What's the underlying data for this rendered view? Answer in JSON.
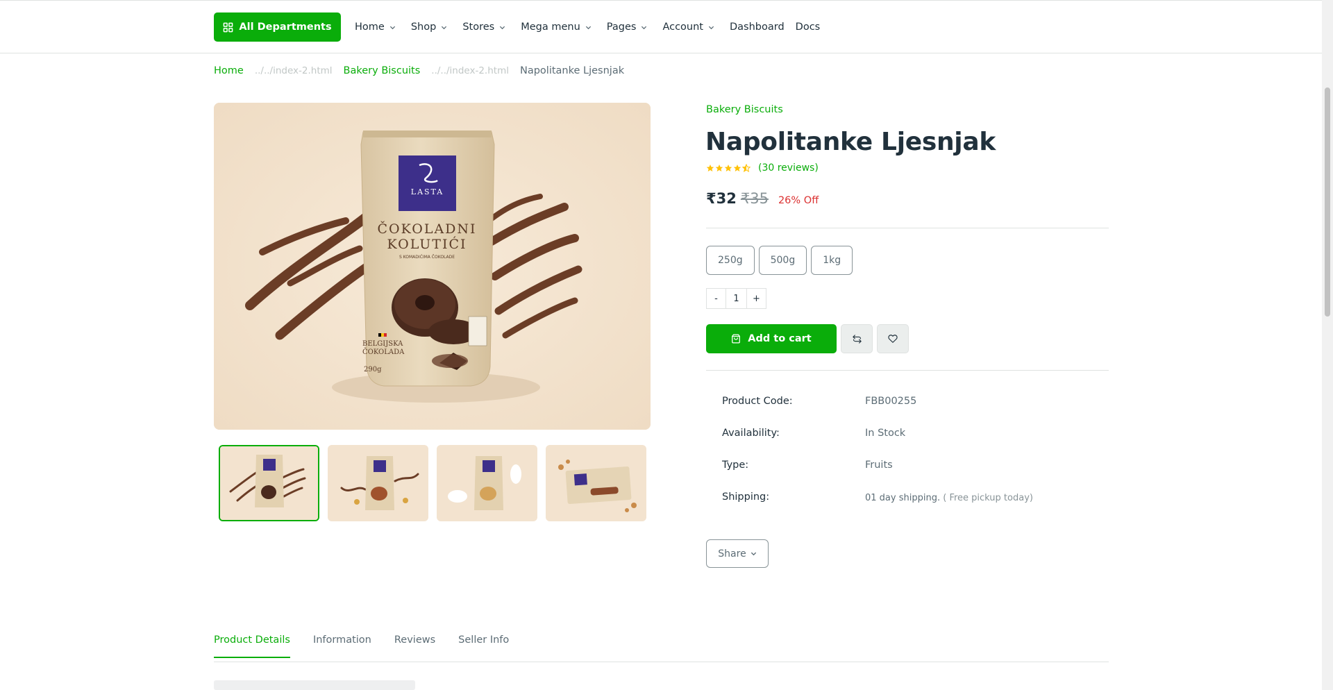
{
  "header": {
    "departments_label": "All Departments",
    "nav": [
      {
        "label": "Home",
        "dropdown": true
      },
      {
        "label": "Shop",
        "dropdown": true
      },
      {
        "label": "Stores",
        "dropdown": true
      },
      {
        "label": "Mega menu",
        "dropdown": true
      },
      {
        "label": "Pages",
        "dropdown": true
      },
      {
        "label": "Account",
        "dropdown": true
      },
      {
        "label": "Dashboard",
        "dropdown": false
      },
      {
        "label": "Docs",
        "dropdown": false
      }
    ]
  },
  "breadcrumb": {
    "home": "Home",
    "broken1": "../../index-2.html",
    "category": "Bakery Biscuits",
    "broken2": "../../index-2.html",
    "current": "Napolitanke Ljesnjak"
  },
  "product": {
    "category": "Bakery Biscuits",
    "title": "Napolitanke Ljesnjak",
    "rating": 4.5,
    "reviews_label": "(30 reviews)",
    "price": "₹32",
    "old_price": "₹35",
    "discount": "26% Off",
    "sizes": [
      "250g",
      "500g",
      "1kg"
    ],
    "qty_minus": "-",
    "quantity": "1",
    "qty_plus": "+",
    "add_to_cart": "Add to cart",
    "package_text": {
      "brand": "LASTA",
      "line1": "ČOKOLADNI",
      "line2": "KOLUTIĆI",
      "tagline": "S KOMADIĆIMA ČOKOLADE",
      "badge1": "BELGIJSKA",
      "badge2": "ČOKOLADA",
      "weight": "290g"
    }
  },
  "details": {
    "code_label": "Product Code:",
    "code_value": "FBB00255",
    "availability_label": "Availability:",
    "availability_value": "In Stock",
    "type_label": "Type:",
    "type_value": "Fruits",
    "shipping_label": "Shipping:",
    "shipping_value": "01 day shipping.",
    "shipping_note": "( Free pickup today)"
  },
  "share_label": "Share",
  "tabs": [
    "Product Details",
    "Information",
    "Reviews",
    "Seller Info"
  ],
  "colors": {
    "primary": "#0aad0a",
    "text": "#21313c",
    "muted": "#5c6c75",
    "danger": "#db3030",
    "star": "#ffc107",
    "image_bg": "#f3e3cf"
  }
}
